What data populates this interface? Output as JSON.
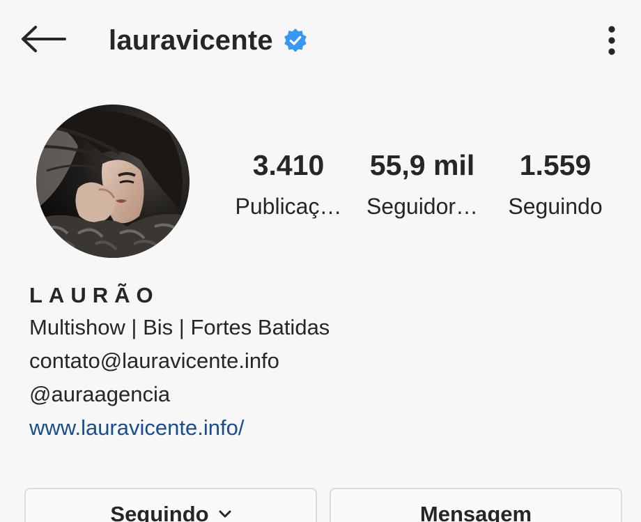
{
  "header": {
    "username": "lauravicente",
    "verified": true,
    "icons": {
      "back": "arrow-left-icon",
      "verified": "verified-badge-icon",
      "menu": "more-vertical-icon"
    }
  },
  "stats": {
    "posts": {
      "value": "3.410",
      "label": "Publicaç…"
    },
    "followers": {
      "value": "55,9 mil",
      "label": "Seguidor…"
    },
    "following": {
      "value": "1.559",
      "label": "Seguindo"
    }
  },
  "bio": {
    "full_name": "LAURÃO",
    "lines": [
      "Multishow | Bis | Fortes Batidas",
      "contato@lauravicente.info",
      "@auraagencia"
    ],
    "website": "www.lauravicente.info/"
  },
  "actions": {
    "following_label": "Seguindo",
    "message_label": "Mensagem"
  },
  "colors": {
    "verified": "#3897f0",
    "link": "#1a4d8c",
    "text": "#262626",
    "background": "#f7f7f7"
  }
}
